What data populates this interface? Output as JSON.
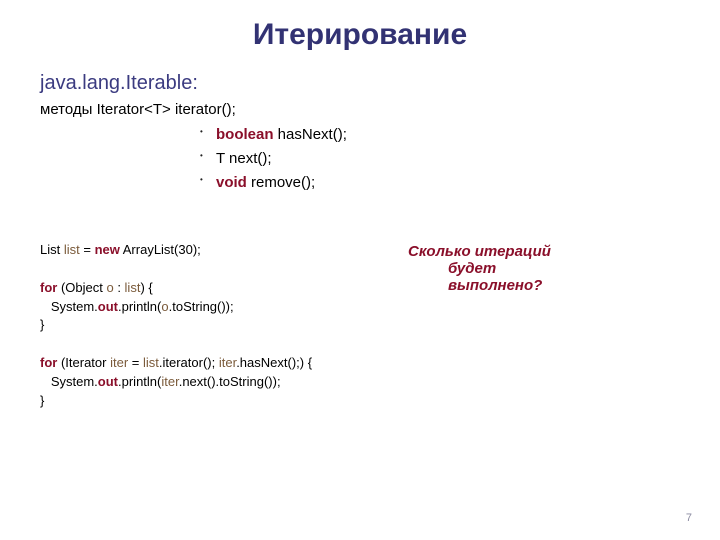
{
  "title": "Итерирование",
  "iterable_heading": "java.lang.Iterable:",
  "methods_prefix": "методы",
  "methods_signature": " Iterator<T> iterator();",
  "bullets": [
    {
      "kw": "boolean",
      "rest": " hasNext();"
    },
    {
      "kw": "",
      "rest": "T next();"
    },
    {
      "kw": "void",
      "rest": " remove();"
    }
  ],
  "code": {
    "l1a": "List ",
    "l1var": "list",
    "l1b": " = ",
    "l1kw": "new",
    "l1c": " ArrayList(30);",
    "l2kw": "for",
    "l2a": " (Object ",
    "l2var1": "o",
    "l2b": " : ",
    "l2var2": "list",
    "l2c": ") {",
    "l3a": "   System.",
    "l3var": "out",
    "l3b": ".println(",
    "l3var2": "o",
    "l3c": ".toString());",
    "l4": "}",
    "l5kw": "for",
    "l5a": " (Iterator ",
    "l5var1": "iter",
    "l5b": " = ",
    "l5var2": "list",
    "l5c": ".iterator(); ",
    "l5var3": "iter",
    "l5d": ".hasNext();) {",
    "l6a": "   System.",
    "l6var": "out",
    "l6b": ".println(",
    "l6var2": "iter",
    "l6c": ".next().toString());",
    "l7": "}"
  },
  "question_line1": "Сколько итераций",
  "question_line2": "будет",
  "question_line3": "выполнено?",
  "page_number": "7"
}
